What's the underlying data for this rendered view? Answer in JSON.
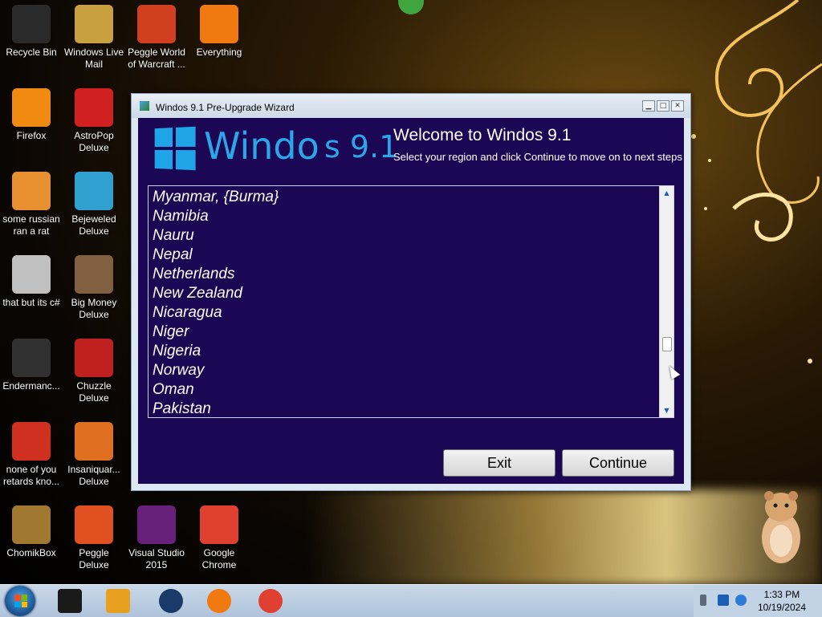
{
  "desktop": {
    "icons": [
      {
        "label": "Recycle Bin",
        "icon": "recycle-bin-icon",
        "color": "#2a2a2a"
      },
      {
        "label": "Windows Live Mail",
        "icon": "mail-icon",
        "color": "#c8a040"
      },
      {
        "label": "Peggle World of Warcraft ...",
        "icon": "peggle-icon",
        "color": "#d04020"
      },
      {
        "label": "Everything",
        "icon": "search-magnifier-icon",
        "color": "#f07a10"
      },
      {
        "label": "Firefox",
        "icon": "firefox-icon",
        "color": "#f08a10"
      },
      {
        "label": "AstroPop Deluxe",
        "icon": "astropop-icon",
        "color": "#d02020"
      },
      {
        "label": "some russian ran a rat",
        "icon": "exe-icon",
        "color": "#e89030"
      },
      {
        "label": "Bejeweled Deluxe",
        "icon": "bejeweled-icon",
        "color": "#30a0d0"
      },
      {
        "label": "that but its c#",
        "icon": "copy-icon",
        "color": "#c0c0c0"
      },
      {
        "label": "Big Money Deluxe",
        "icon": "big-money-icon",
        "color": "#806040"
      },
      {
        "label": "Endermanc...",
        "icon": "window-icon",
        "color": "#303030"
      },
      {
        "label": "Chuzzle Deluxe",
        "icon": "chuzzle-icon",
        "color": "#c02020"
      },
      {
        "label": "none of you retards kno...",
        "icon": "chrome-like-icon",
        "color": "#d03020"
      },
      {
        "label": "Insaniquar... Deluxe",
        "icon": "fish-icon",
        "color": "#e07020"
      },
      {
        "label": "ChomikBox",
        "icon": "hamster-app-icon",
        "color": "#a07830"
      },
      {
        "label": "Peggle Deluxe",
        "icon": "peggle-icon",
        "color": "#e05020"
      },
      {
        "label": "Visual Studio 2015",
        "icon": "visual-studio-icon",
        "color": "#68217a"
      },
      {
        "label": "Google Chrome",
        "icon": "chrome-icon",
        "color": "#e04030"
      }
    ]
  },
  "window": {
    "title": "Windos 9.1 Pre-Upgrade Wizard",
    "logo_text": "Windo",
    "logo_tail": "s 9.1",
    "heading": "Welcome to Windos 9.1",
    "subtitle": "Select your region and click Continue to move on to next steps",
    "regions": [
      "Myanmar, {Burma}",
      "Namibia",
      "Nauru",
      "Nepal",
      "Netherlands",
      "New Zealand",
      "Nicaragua",
      "Niger",
      "Nigeria",
      "Norway",
      "Oman",
      "Pakistan"
    ],
    "exit_label": "Exit",
    "continue_label": "Continue",
    "accent_color": "#1c0754",
    "logo_color": "#2ba6e8"
  },
  "taskbar": {
    "pinned": [
      {
        "name": "taskbar-item-terminal",
        "icon": "terminal-icon",
        "color": "#1a1a1a"
      },
      {
        "name": "taskbar-item-media-player",
        "icon": "media-player-icon",
        "color": "#e8a020"
      },
      {
        "name": "taskbar-item-globe",
        "icon": "globe-icon",
        "color": "#1a3a6a"
      },
      {
        "name": "taskbar-item-firefox",
        "icon": "firefox-icon",
        "color": "#f07a10"
      },
      {
        "name": "taskbar-item-chrome",
        "icon": "chrome-icon",
        "color": "#e04030"
      }
    ],
    "time": "1:33 PM",
    "date": "10/19/2024"
  }
}
